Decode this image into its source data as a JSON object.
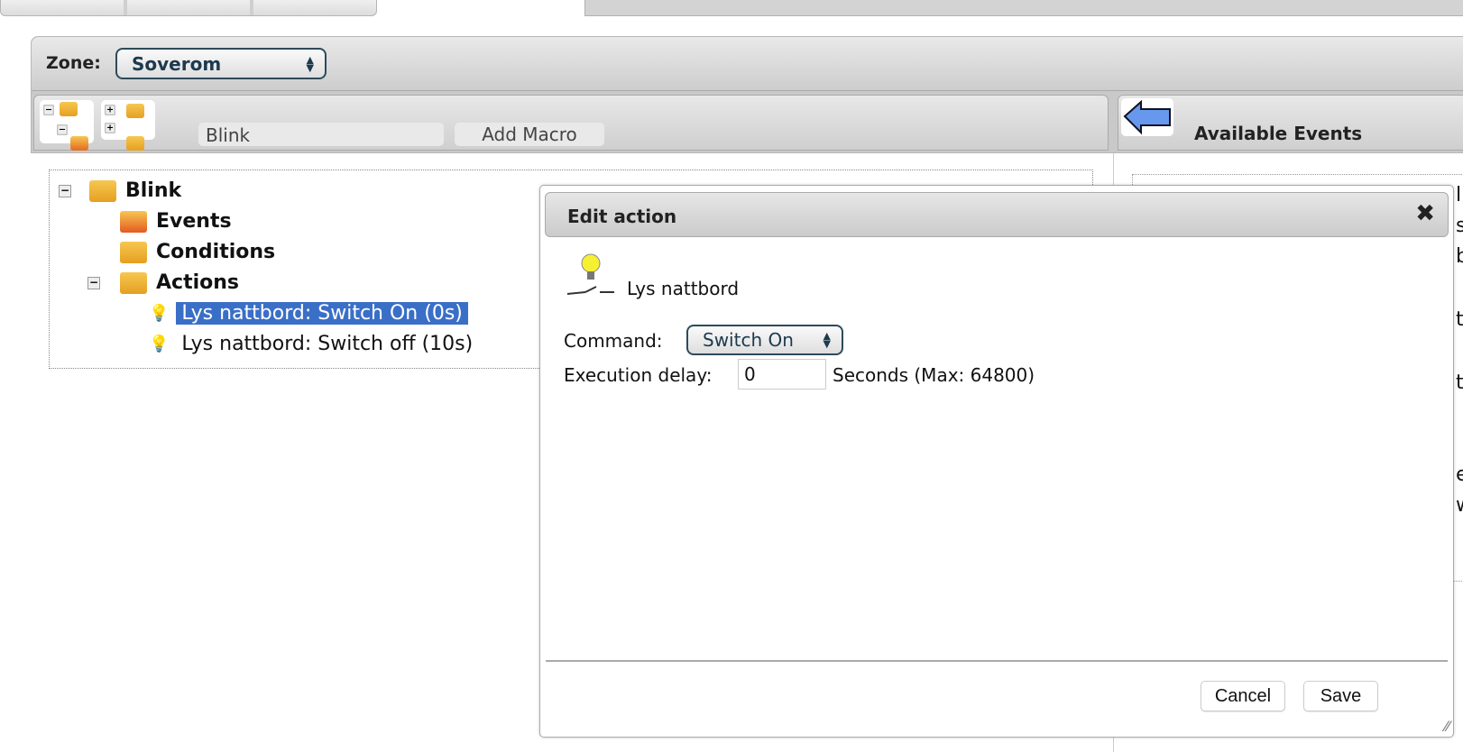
{
  "zone": {
    "label": "Zone:",
    "selected": "Soverom"
  },
  "toolbar": {
    "macro_name_value": "Blink",
    "add_macro_label": "Add Macro",
    "available_events_title": "Available Events"
  },
  "tree": {
    "root": "Blink",
    "events": "Events",
    "conditions": "Conditions",
    "actions": "Actions",
    "action_items": [
      "Lys nattbord: Switch On (0s)",
      "Lys nattbord: Switch off (10s)"
    ]
  },
  "dialog": {
    "title": "Edit action",
    "device_name": "Lys nattbord",
    "command_label": "Command:",
    "command_value": "Switch On",
    "delay_label": "Execution delay:",
    "delay_value": "0",
    "delay_hint": "Seconds (Max: 64800)",
    "cancel": "Cancel",
    "save": "Save"
  },
  "right_fragments": [
    "l,",
    "s",
    "b",
    "ta",
    "ta",
    "e",
    "w"
  ],
  "colors": {
    "selection": "#3a6fc7",
    "select_border": "#2e4a5a",
    "arrow": "#6699ee"
  }
}
